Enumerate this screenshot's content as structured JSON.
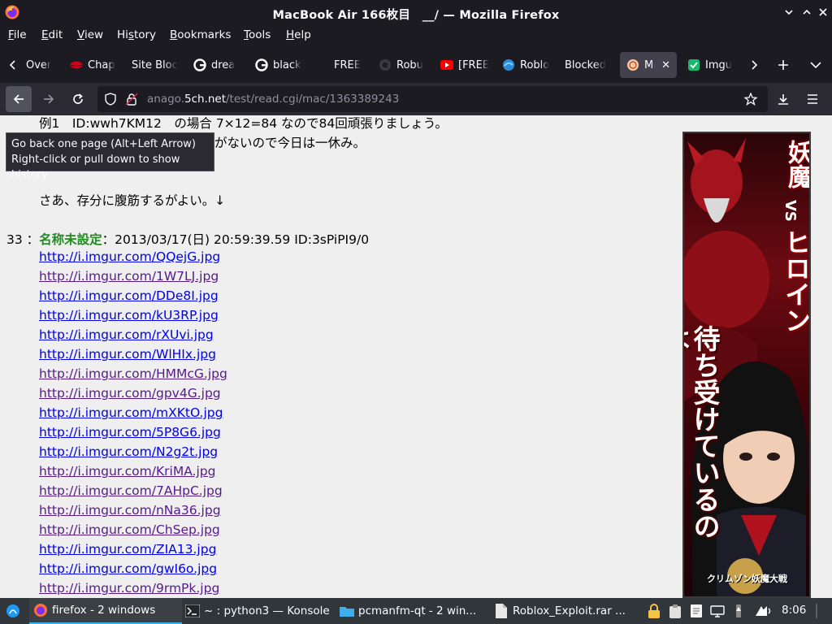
{
  "window": {
    "title": "MacBook Air 166枚目　__/ — Mozilla Firefox"
  },
  "menubar": [
    {
      "label": "File",
      "u": "F",
      "rest": "ile"
    },
    {
      "label": "Edit",
      "u": "E",
      "rest": "dit"
    },
    {
      "label": "View",
      "u": "V",
      "rest": "iew"
    },
    {
      "label": "History",
      "u": "s",
      "pre": "Hi",
      "rest": "tory"
    },
    {
      "label": "Bookmarks",
      "u": "B",
      "rest": "ookmarks"
    },
    {
      "label": "Tools",
      "u": "T",
      "rest": "ools"
    },
    {
      "label": "Help",
      "u": "H",
      "rest": "elp"
    }
  ],
  "tabs": [
    {
      "label": "Over",
      "icon": "none"
    },
    {
      "label": "Chap",
      "icon": "red-lips-icon"
    },
    {
      "label": "Site Bloc",
      "icon": "none"
    },
    {
      "label": "drea",
      "icon": "google-icon"
    },
    {
      "label": "black",
      "icon": "google-icon"
    },
    {
      "label": "FREE",
      "icon": "none"
    },
    {
      "label": "Robu",
      "icon": "roblox-icon"
    },
    {
      "label": "[FREE",
      "icon": "youtube-icon"
    },
    {
      "label": "Roblo",
      "icon": "edge-icon"
    },
    {
      "label": "Blocked",
      "icon": "none"
    },
    {
      "label": "Ma",
      "icon": "5ch-icon",
      "active": true
    },
    {
      "label": "Imgu",
      "icon": "imgur-icon"
    }
  ],
  "url": {
    "prefix": "anago.",
    "domain": "5ch.net",
    "path": "/test/read.cgi/mac/1363389243"
  },
  "tooltip": {
    "line1": "Go back one page (Alt+Left Arrow)",
    "line2": "Right-click or pull down to show history"
  },
  "post_prev": {
    "line1": "例1　ID:wwh7KM12　の場合 7×12=84 なので84回頑張りましょう。",
    "line2": "がないので今日は一休み。",
    "line3": "さあ、存分に腹筋するがよい。↓"
  },
  "post33": {
    "number": "33 ：",
    "name": "名称未設定",
    "meta": "：2013/03/17(日) 20:59:39.59 ID:3sPiPI9/0",
    "links": [
      {
        "text": "http://i.imgur.com/QQejG.jpg",
        "visited": false
      },
      {
        "text": "http://i.imgur.com/1W7LJ.jpg",
        "visited": true
      },
      {
        "text": "http://i.imgur.com/DDe8I.jpg",
        "visited": false
      },
      {
        "text": "http://i.imgur.com/kU3RP.jpg",
        "visited": false
      },
      {
        "text": "http://i.imgur.com/rXUvi.jpg",
        "visited": false
      },
      {
        "text": "http://i.imgur.com/WlHIx.jpg",
        "visited": false
      },
      {
        "text": "http://i.imgur.com/HMMcG.jpg",
        "visited": true
      },
      {
        "text": "http://i.imgur.com/gpv4G.jpg",
        "visited": true
      },
      {
        "text": "http://i.imgur.com/mXKtO.jpg",
        "visited": false
      },
      {
        "text": "http://i.imgur.com/5P8G6.jpg",
        "visited": false
      },
      {
        "text": "http://i.imgur.com/N2g2t.jpg",
        "visited": false
      },
      {
        "text": "http://i.imgur.com/KriMA.jpg",
        "visited": true
      },
      {
        "text": "http://i.imgur.com/7AHpC.jpg",
        "visited": true
      },
      {
        "text": "http://i.imgur.com/nNa36.jpg",
        "visited": true
      },
      {
        "text": "http://i.imgur.com/ChSep.jpg",
        "visited": true
      },
      {
        "text": "http://i.imgur.com/ZIA13.jpg",
        "visited": false
      },
      {
        "text": "http://i.imgur.com/gwI6o.jpg",
        "visited": false
      },
      {
        "text": "http://i.imgur.com/9rmPk.jpg",
        "visited": true
      }
    ]
  },
  "ad": {
    "title1": "妖魔",
    "vs": "VS",
    "title2": "ヒロイン",
    "tagline": "待ち受けているのは…",
    "logo": "クリムゾン妖魔大戦"
  },
  "taskbar": {
    "tasks": [
      {
        "label": "firefox - 2 windows",
        "icon": "firefox-icon",
        "active": true
      },
      {
        "label": "~ : python3 — Konsole",
        "icon": "terminal-icon"
      },
      {
        "label": "pcmanfm-qt - 2 win...",
        "icon": "folder-icon"
      },
      {
        "label": "Roblox_Exploit.rar ...",
        "icon": "file-icon"
      }
    ],
    "clock": "8:06"
  },
  "colors": {
    "accent": "#3daee9",
    "link": "#0000ee",
    "visited": "#551a8b",
    "poster": "#228b22"
  }
}
